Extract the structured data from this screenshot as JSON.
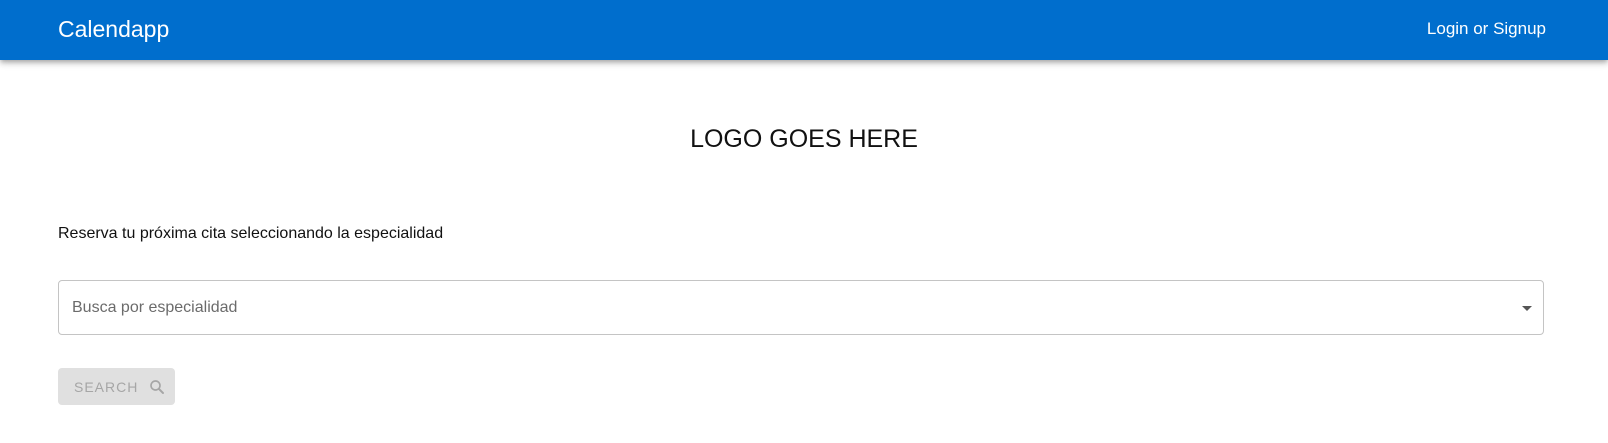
{
  "header": {
    "brand": "Calendapp",
    "login_label": "Login or Signup",
    "background_color": "#006ecd"
  },
  "main": {
    "logo_text": "LOGO GOES HERE",
    "subtitle": "Reserva tu próxima cita seleccionando la especialidad",
    "specialty_select": {
      "placeholder": "Busca por especialidad",
      "icon": "arrow-drop-down-icon"
    },
    "search_button": {
      "label": "SEARCH",
      "icon": "search-icon",
      "disabled": true
    }
  }
}
